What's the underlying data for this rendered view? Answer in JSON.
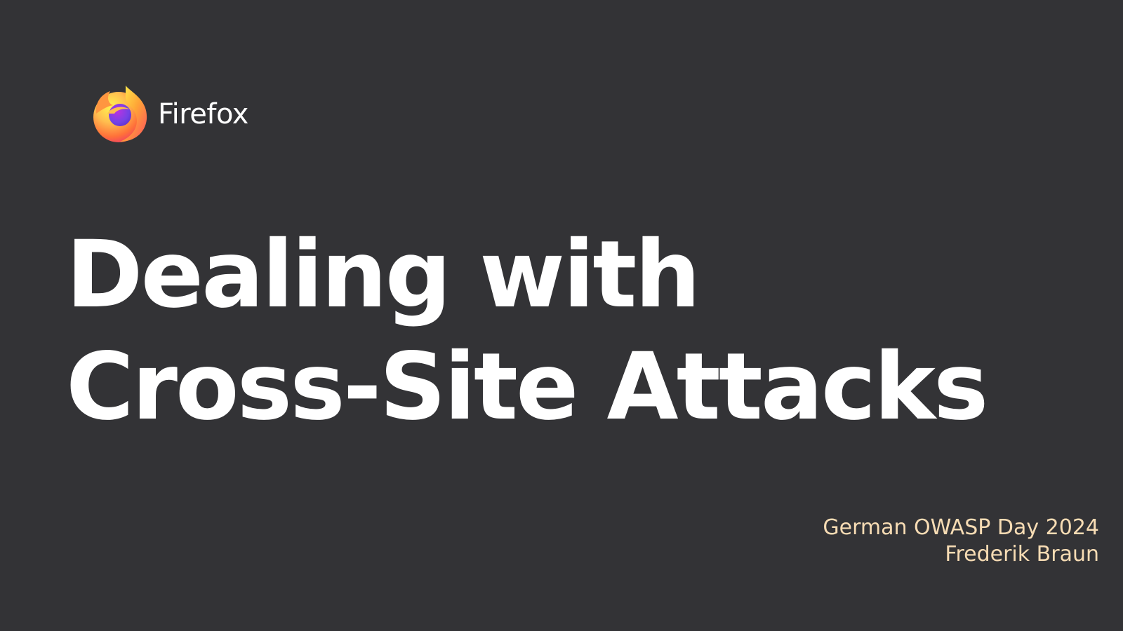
{
  "brand": {
    "name": "Firefox",
    "logo_icon": "firefox-logo-icon"
  },
  "title": {
    "line1": "Dealing with",
    "line2": "Cross-Site Attacks"
  },
  "meta": {
    "event": "German OWASP Day 2024",
    "author": "Frederik Braun"
  },
  "colors": {
    "background": "#333336",
    "title_text": "#ffffff",
    "meta_text": "#f7dcb4",
    "logo_orange": "#ff7139",
    "logo_purple": "#7542e5"
  }
}
